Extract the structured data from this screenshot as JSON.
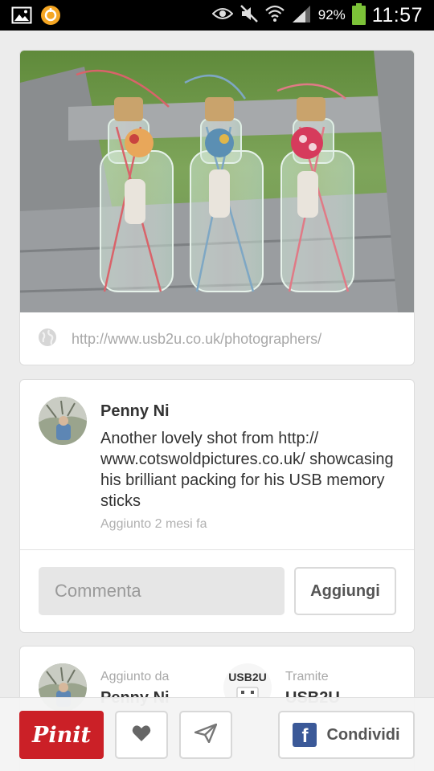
{
  "status_bar": {
    "battery_percent": "92%",
    "time": "11:57",
    "battery_level": 0.92
  },
  "pin": {
    "source_url": "http://www.usb2u.co.uk/photographers/",
    "author": "Penny Ni",
    "description": "Another lovely shot from http:// www.cotswoldpictures.co.uk/ showcasing his brilliant packing for his USB memory sticks",
    "timestamp": "Aggiunto 2 mesi fa"
  },
  "comment": {
    "placeholder": "Commenta",
    "add_label": "Aggiungi"
  },
  "credits": {
    "added_by_label": "Aggiunto da",
    "added_by_name": "Penny Ni",
    "via_label": "Tramite",
    "via_name": "USB2U",
    "via_logo_text": "USB2U"
  },
  "actions": {
    "pinit_label": "Pinit",
    "like_icon": "heart-icon",
    "send_icon": "send-icon",
    "share_label": "Condividi",
    "share_icon": "facebook-icon"
  },
  "colors": {
    "pinterest_red": "#cb2027",
    "facebook_blue": "#3b5998",
    "battery_green": "#7cc238"
  }
}
